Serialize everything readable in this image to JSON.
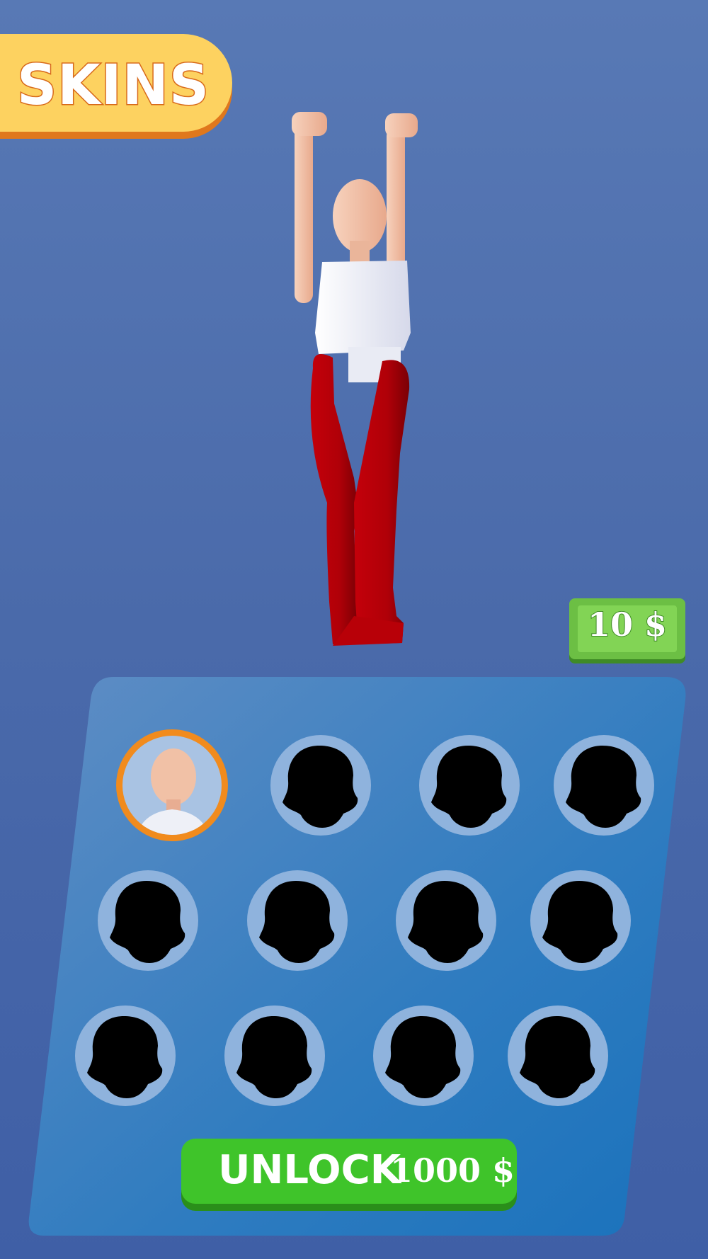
{
  "header": {
    "title": "SKINS"
  },
  "currency": {
    "balance_label": "10 $"
  },
  "skins": {
    "selected_index": 0,
    "total": 12
  },
  "unlock": {
    "label": "UNLOCK",
    "price": "1000 $"
  },
  "colors": {
    "background": "#5073b0",
    "banner": "#fdd260",
    "selected_ring": "#f18b1d",
    "unlock_button": "#3fc42a",
    "cash": "#6cbf44"
  }
}
